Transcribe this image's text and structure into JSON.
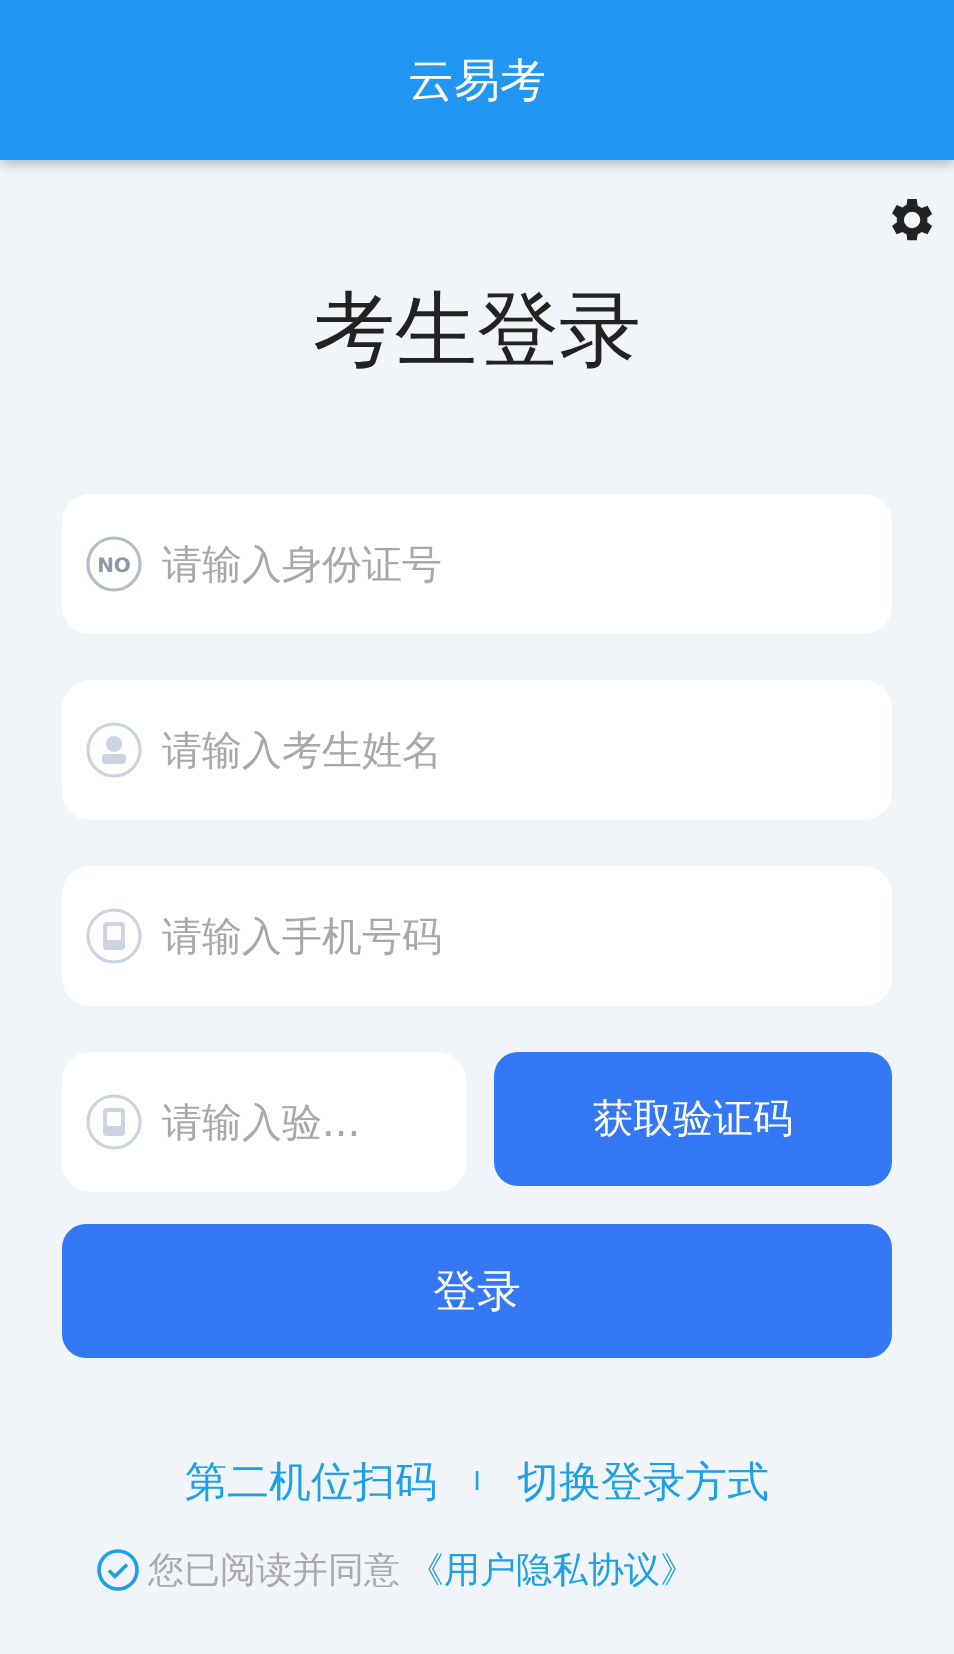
{
  "app_bar": {
    "title": "云易考"
  },
  "page_title": "考生登录",
  "fields": [
    {
      "kind": "id",
      "icon_label": "NO",
      "placeholder": "请输入身份证号"
    },
    {
      "kind": "person",
      "placeholder": "请输入考生姓名"
    },
    {
      "kind": "phone",
      "placeholder": "请输入手机号码"
    }
  ],
  "code_row": {
    "field": {
      "kind": "phone",
      "placeholder": "请输入验..."
    },
    "button": "获取验证码"
  },
  "login_button": "登录",
  "links": [
    "第二机位扫码",
    "切换登录方式"
  ],
  "link_separator": "I",
  "agreement": {
    "checked": true,
    "text": "您已阅读并同意",
    "link": "《用户隐私协议》"
  }
}
